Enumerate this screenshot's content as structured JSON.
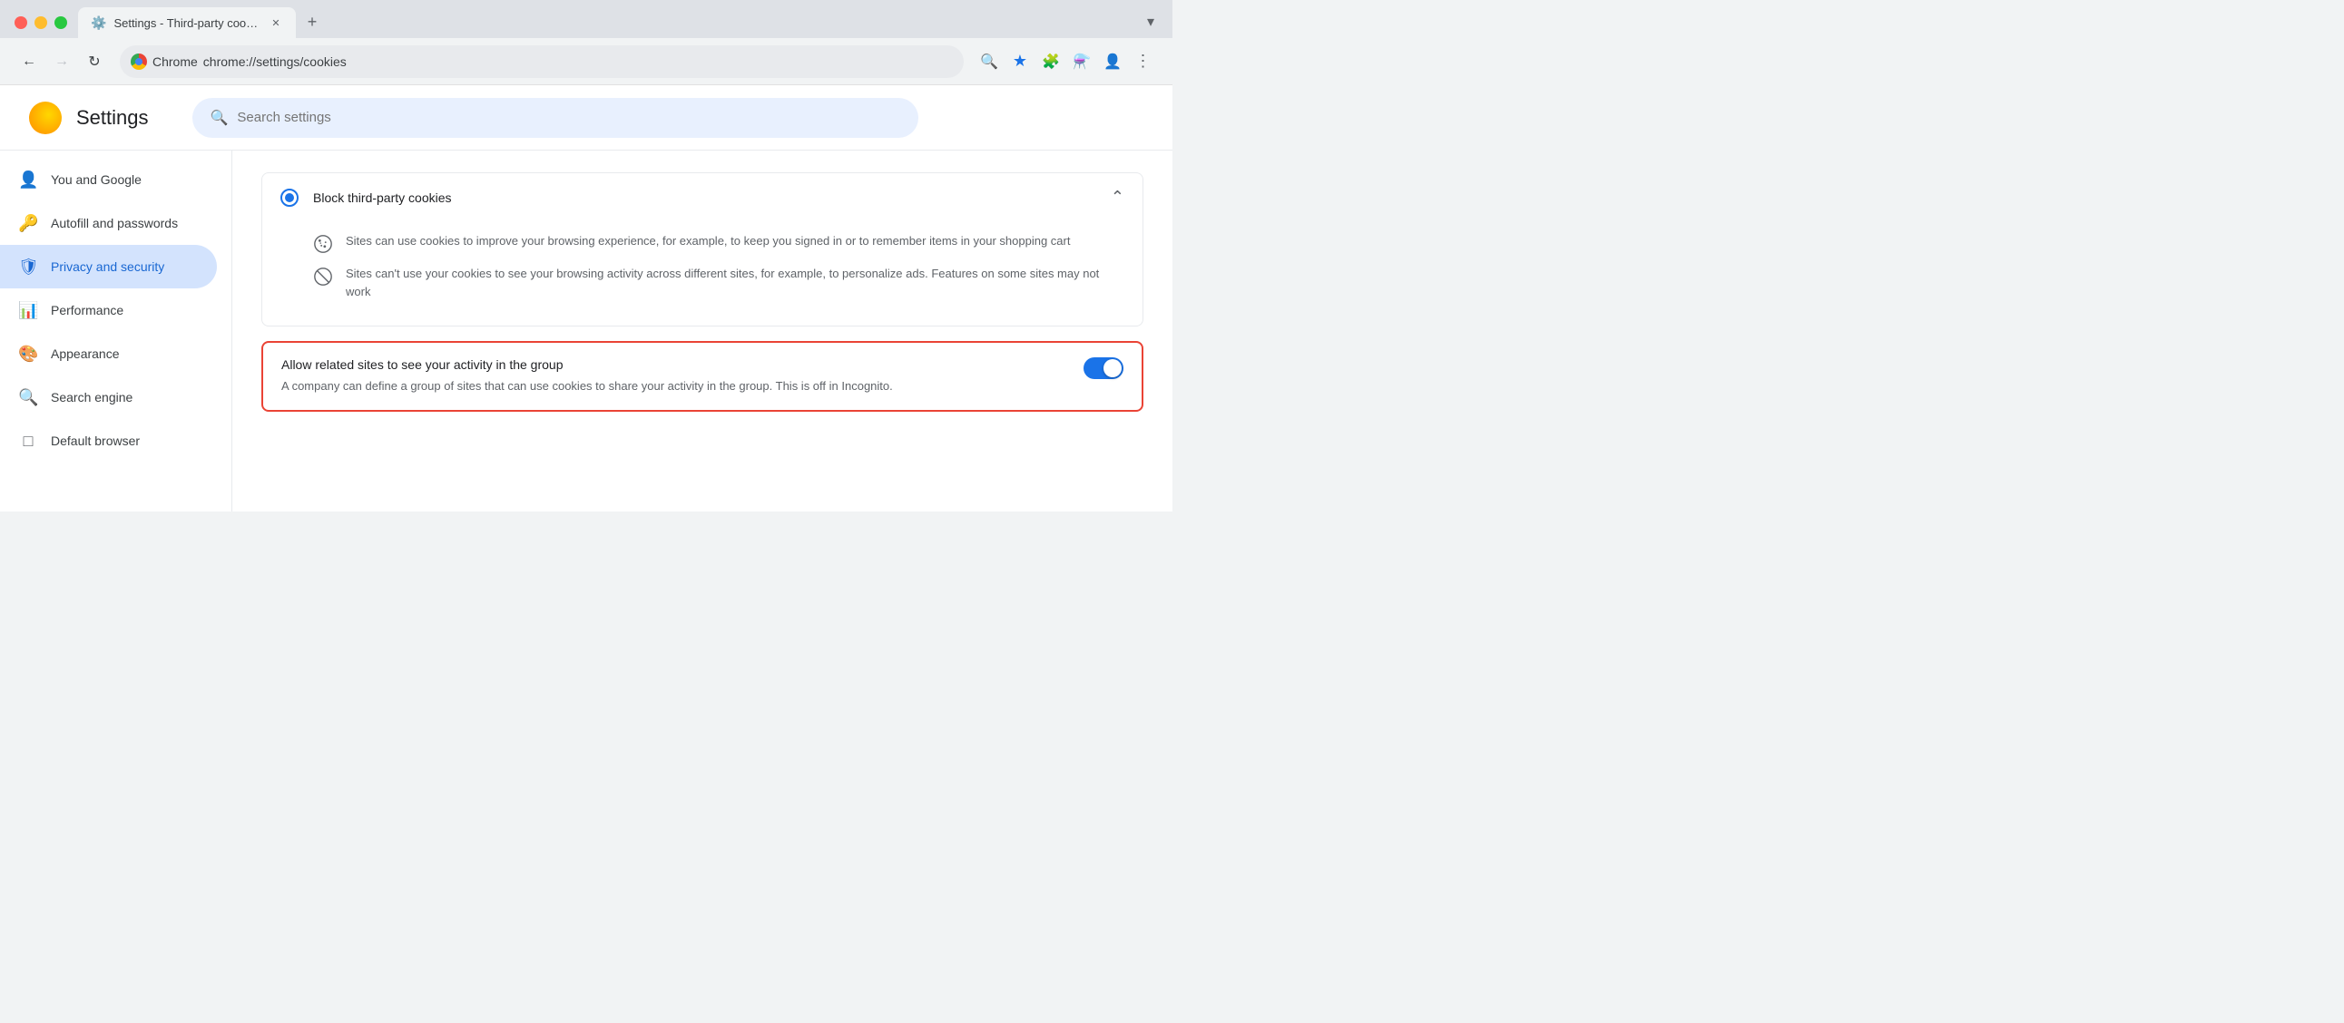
{
  "browser": {
    "title": "Settings - Third-party cookies",
    "tab_title": "Settings - Third-party cookie...",
    "url_display": "chrome://settings/cookies",
    "chrome_label": "Chrome",
    "new_tab_label": "+",
    "back_disabled": false,
    "forward_disabled": true
  },
  "header": {
    "settings_title": "Settings",
    "search_placeholder": "Search settings"
  },
  "sidebar": {
    "items": [
      {
        "id": "you-and-google",
        "label": "You and Google",
        "icon": "person"
      },
      {
        "id": "autofill",
        "label": "Autofill and passwords",
        "icon": "key"
      },
      {
        "id": "privacy",
        "label": "Privacy and security",
        "icon": "shield",
        "active": true
      },
      {
        "id": "performance",
        "label": "Performance",
        "icon": "gauge"
      },
      {
        "id": "appearance",
        "label": "Appearance",
        "icon": "palette"
      },
      {
        "id": "search-engine",
        "label": "Search engine",
        "icon": "search"
      },
      {
        "id": "default-browser",
        "label": "Default browser",
        "icon": "browser"
      }
    ]
  },
  "main": {
    "block_option": {
      "label": "Block third-party cookies",
      "selected": true,
      "info1": "Sites can use cookies to improve your browsing experience, for example, to keep you signed in or to remember items in your shopping cart",
      "info2": "Sites can't use your cookies to see your browsing activity across different sites, for example, to personalize ads. Features on some sites may not work"
    },
    "highlighted": {
      "title": "Allow related sites to see your activity in the group",
      "description": "A company can define a group of sites that can use cookies to share your activity in the group. This is off in Incognito.",
      "toggle_on": true
    }
  }
}
